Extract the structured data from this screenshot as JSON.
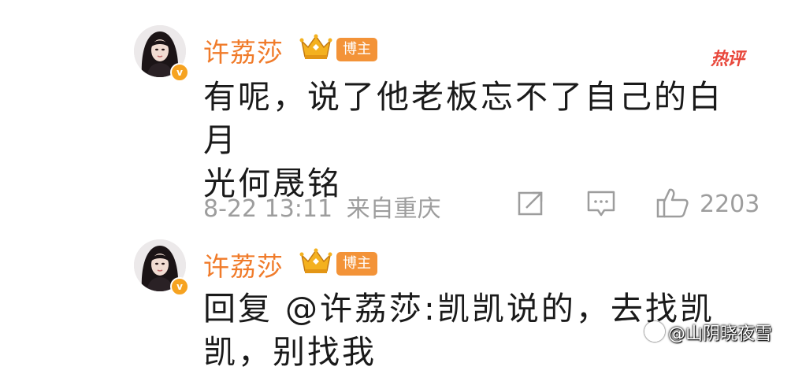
{
  "comments": [
    {
      "username": "许荔莎",
      "badge_label": "博主",
      "hot_label": "热评",
      "text": "有呢，说了他老板忘不了自己的白月\n光何晟铭",
      "timestamp": "8-22 13:11",
      "source": "来自重庆",
      "likes": "2203"
    },
    {
      "username": "许荔莎",
      "badge_label": "博主",
      "text": "回复 @许荔莎:凯凯说的，去找凯\n凯，别找我"
    }
  ],
  "icons": {
    "avatar": "avatar-photo",
    "verified": "verified-v-icon",
    "crown": "crown-icon",
    "share": "share-icon",
    "reply": "comment-icon",
    "like": "thumbs-up-icon",
    "watermark": "watermark-logo-icon"
  },
  "colors": {
    "username": "#f07b2a",
    "badge": "#f39338",
    "hot": "#e8473b",
    "meta": "#9d9d9d",
    "text": "#1a1a1a"
  },
  "watermark": "@山阴晓夜雪"
}
